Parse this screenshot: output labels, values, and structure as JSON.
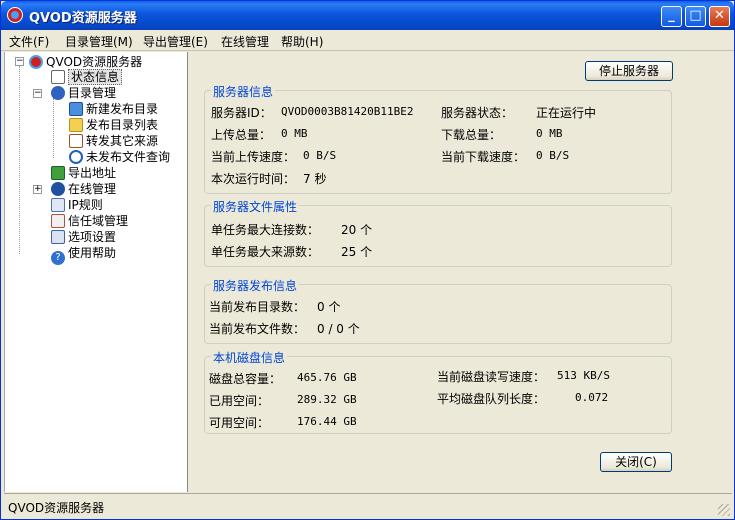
{
  "window": {
    "title": "QVOD资源服务器",
    "min_label": "_",
    "max_label": "□",
    "close_label": "✕"
  },
  "menu": [
    "文件(F)",
    "目录管理(M)",
    "导出管理(E)",
    "在线管理",
    "帮助(H)"
  ],
  "tree": {
    "root": "QVOD资源服务器",
    "items": [
      "状态信息",
      "目录管理",
      "新建发布目录",
      "发布目录列表",
      "转发其它来源",
      "未发布文件查询",
      "导出地址",
      "在线管理",
      "IP规则",
      "信任域管理",
      "选项设置",
      "使用帮助"
    ]
  },
  "buttons": {
    "stop": "停止服务器",
    "close": "关闭(C)"
  },
  "server_info": {
    "title": "服务器信息",
    "id_label": "服务器ID：",
    "id_value": "QVOD0003B81420B11BE2",
    "status_label": "服务器状态：",
    "status_value": "正在运行中",
    "upload_total_label": "上传总量：",
    "upload_total_value": "0 MB",
    "download_total_label": "下载总量：",
    "download_total_value": "0 MB",
    "upload_speed_label": "当前上传速度：",
    "upload_speed_value": "0 B/S",
    "download_speed_label": "当前下载速度：",
    "download_speed_value": "0 B/S",
    "runtime_label": "本次运行时间：",
    "runtime_value": "7 秒"
  },
  "file_props": {
    "title": "服务器文件属性",
    "max_conn_label": "单任务最大连接数：",
    "max_conn_value": "20 个",
    "max_src_label": "单任务最大来源数：",
    "max_src_value": "25 个"
  },
  "publish_info": {
    "title": "服务器发布信息",
    "dirs_label": "当前发布目录数：",
    "dirs_value": "0 个",
    "files_label": "当前发布文件数：",
    "files_value": "0 / 0 个"
  },
  "disk_info": {
    "title": "本机磁盘信息",
    "total_label": "磁盘总容量：",
    "total_value": "465.76 GB",
    "used_label": "已用空间：",
    "used_value": "289.32 GB",
    "free_label": "可用空间：",
    "free_value": "176.44 GB",
    "rw_label": "当前磁盘读写速度：",
    "rw_value": "513 KB/S",
    "queue_label": "平均磁盘队列长度：",
    "queue_value": "0.072"
  },
  "status_bar": "QVOD资源服务器",
  "colors": {
    "title_blue": "#0a55dc",
    "group_title": "#0046d5",
    "face": "#ece9d8"
  }
}
